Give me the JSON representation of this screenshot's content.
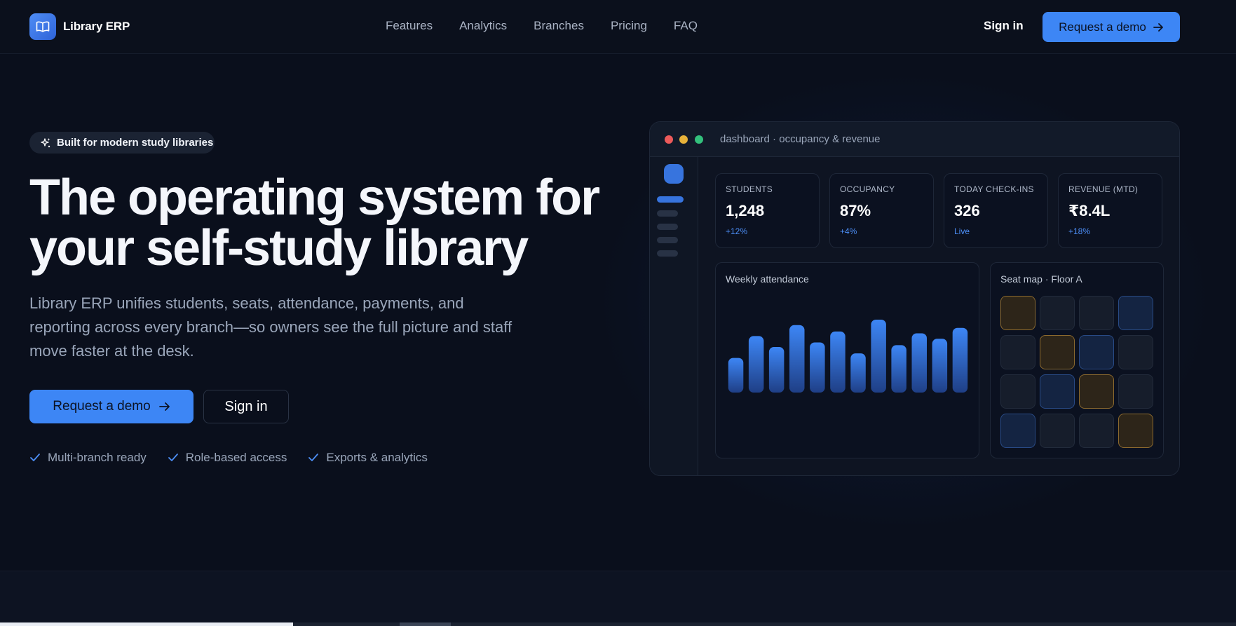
{
  "nav": {
    "brand": "Library ERP",
    "links": [
      "Features",
      "Analytics",
      "Branches",
      "Pricing",
      "FAQ"
    ],
    "signin": "Sign in",
    "cta": "Request a demo"
  },
  "hero": {
    "badge": "Built for modern study libraries",
    "headline_line1": "The operating system for",
    "headline_line2": "your self-study library",
    "subtitle": "Library ERP unifies students, seats, attendance, payments, and reporting across every branch—so owners see the full picture and staff move faster at the desk.",
    "primary_cta": "Request a demo",
    "secondary_cta": "Sign in",
    "features": [
      "Multi-branch ready",
      "Role-based access",
      "Exports & analytics"
    ]
  },
  "dashboard": {
    "window_title": "dashboard · occupancy & revenue",
    "kpis": [
      {
        "label": "STUDENTS",
        "value": "1,248",
        "delta": "+12%"
      },
      {
        "label": "OCCUPANCY",
        "value": "87%",
        "delta": "+4%"
      },
      {
        "label": "TODAY CHECK-INS",
        "value": "326",
        "delta": "Live"
      },
      {
        "label": "REVENUE (MTD)",
        "value": "₹8.4L",
        "delta": "+18%"
      }
    ],
    "attendance_title": "Weekly attendance",
    "seatmap_title": "Seat map · Floor A",
    "seat_rows": [
      [
        "booked",
        "empty",
        "empty",
        "reserved"
      ],
      [
        "empty",
        "booked",
        "reserved",
        "empty"
      ],
      [
        "empty",
        "reserved",
        "booked",
        "empty"
      ],
      [
        "reserved",
        "empty",
        "empty",
        "booked"
      ]
    ]
  },
  "chart_data": {
    "type": "bar",
    "title": "Weekly attendance",
    "categories": [],
    "values": [
      38,
      62,
      50,
      74,
      55,
      67,
      43,
      80,
      52,
      65,
      59,
      71
    ],
    "ylim": [
      0,
      100
    ],
    "color": "#3d86f5"
  },
  "colors": {
    "background": "#0a0f1c",
    "accent": "#3d86f5",
    "dot_red": "#ec5a5a",
    "dot_yellow": "#e7b23a",
    "dot_green": "#33c07c"
  }
}
